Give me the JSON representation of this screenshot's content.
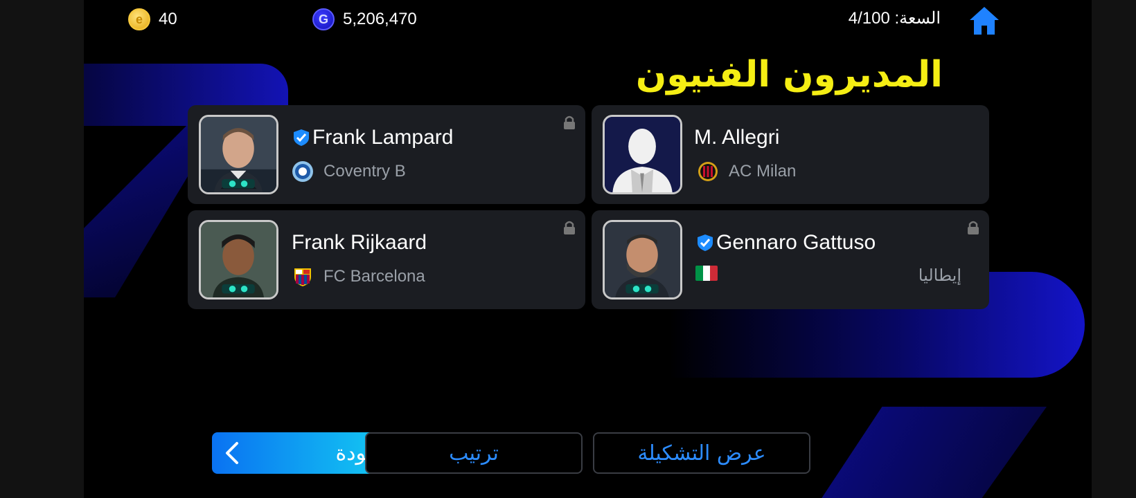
{
  "topbar": {
    "ecoins": "40",
    "gp": "5,206,470",
    "capacity": "السعة: 4/100"
  },
  "title": "المديرون الفنيون",
  "managers": [
    {
      "name": "Frank Lampard",
      "club": "Coventry B",
      "verified": true,
      "locked": true
    },
    {
      "name": "M. Allegri",
      "club": "AC Milan",
      "verified": false,
      "locked": false
    },
    {
      "name": "Frank Rijkaard",
      "club": "FC Barcelona",
      "verified": false,
      "locked": true
    },
    {
      "name": "Gennaro Gattuso",
      "nationality": "إيطاليا",
      "verified": true,
      "locked": true
    }
  ],
  "buttons": {
    "back": "العودة",
    "sort": "ترتيب",
    "formation": "عرض التشكيلة"
  },
  "colors": {
    "title": "#f5ee14",
    "accent": "#2c8cff",
    "card_bg": "#1b1d22"
  }
}
